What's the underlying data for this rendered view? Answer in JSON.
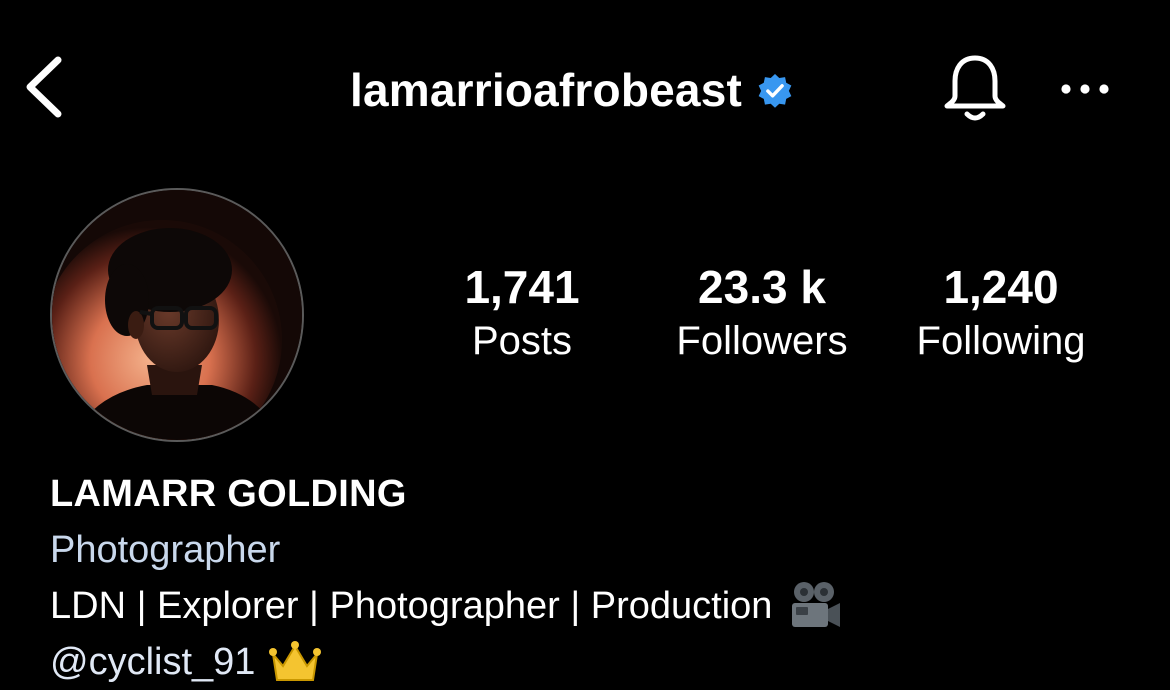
{
  "header": {
    "username": "lamarrioafrobeast",
    "verified": true,
    "back_icon": "chevron-left-icon",
    "bell_icon": "bell-icon",
    "more_icon": "more-horizontal-icon"
  },
  "stats": {
    "posts": {
      "value": "1,741",
      "label": "Posts"
    },
    "followers": {
      "value": "23.3 k",
      "label": "Followers"
    },
    "following": {
      "value": "1,240",
      "label": "Following"
    }
  },
  "bio": {
    "full_name": "LAMARR GOLDING",
    "category": "Photographer",
    "description": "LDN | Explorer | Photographer | Production",
    "mention": "@cyclist_91",
    "emoji_1": "movie-camera",
    "emoji_2": "crown"
  },
  "colors": {
    "background": "#000000",
    "text": "#ffffff",
    "verified_badge": "#3897f0",
    "category": "#c9d8ec"
  }
}
